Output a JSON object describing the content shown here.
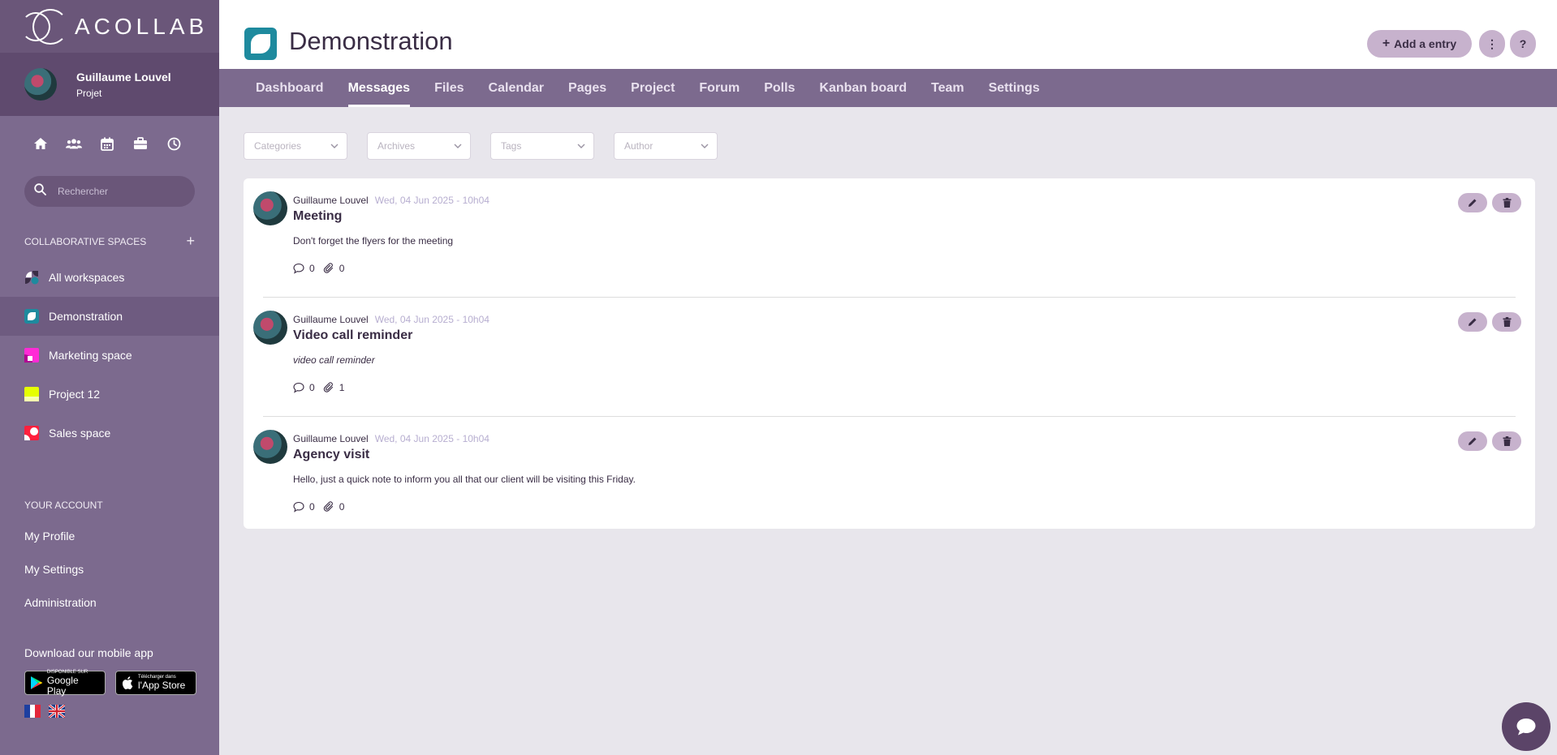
{
  "brand": {
    "name": "ACOLLAB"
  },
  "user": {
    "name": "Guillaume Louvel",
    "role": "Projet"
  },
  "quick_icons": [
    "home-icon",
    "users-icon",
    "calendar-icon",
    "briefcase-icon",
    "clock-icon"
  ],
  "search": {
    "placeholder": "Rechercher"
  },
  "spaces_section": {
    "title": "COLLABORATIVE SPACES",
    "add": "+"
  },
  "workspaces": [
    {
      "label": "All workspaces"
    },
    {
      "label": "Demonstration"
    },
    {
      "label": "Marketing space"
    },
    {
      "label": "Project 12"
    },
    {
      "label": "Sales space"
    }
  ],
  "account_section": {
    "title": "YOUR ACCOUNT",
    "links": [
      "My Profile",
      "My Settings",
      "Administration"
    ]
  },
  "mobile": {
    "title": "Download our mobile app",
    "google_small": "DISPONIBLE SUR",
    "google_big": "Google Play",
    "apple_small": "Télécharger dans",
    "apple_big": "l'App Store"
  },
  "header": {
    "title": "Demonstration",
    "add_button": "Add a entry",
    "more_button": "⋮",
    "help_button": "?"
  },
  "tabs": [
    "Dashboard",
    "Messages",
    "Files",
    "Calendar",
    "Pages",
    "Project",
    "Forum",
    "Polls",
    "Kanban board",
    "Team",
    "Settings"
  ],
  "filters": [
    "Categories",
    "Archives",
    "Tags",
    "Author"
  ],
  "messages": [
    {
      "author": "Guillaume Louvel",
      "date": "Wed, 04 Jun 2025 - 10h04",
      "title": "Meeting",
      "body": "Don't forget the flyers for the meeting",
      "comments": "0",
      "attachments": "0"
    },
    {
      "author": "Guillaume Louvel",
      "date": "Wed, 04 Jun 2025 - 10h04",
      "title": "Video call reminder",
      "body": "video call reminder",
      "comments": "0",
      "attachments": "1"
    },
    {
      "author": "Guillaume Louvel",
      "date": "Wed, 04 Jun 2025 - 10h04",
      "title": "Agency visit",
      "body": "Hello, just a quick note to inform you all that our client will be visiting this Friday.",
      "comments": "0",
      "attachments": "0"
    }
  ],
  "colors": {
    "sidebar": "#7c6a8e",
    "sidebar_dark": "#5f4a6e",
    "accent_button": "#c7b2cd",
    "teal": "#1e8a9e",
    "text": "#3a2d45"
  }
}
